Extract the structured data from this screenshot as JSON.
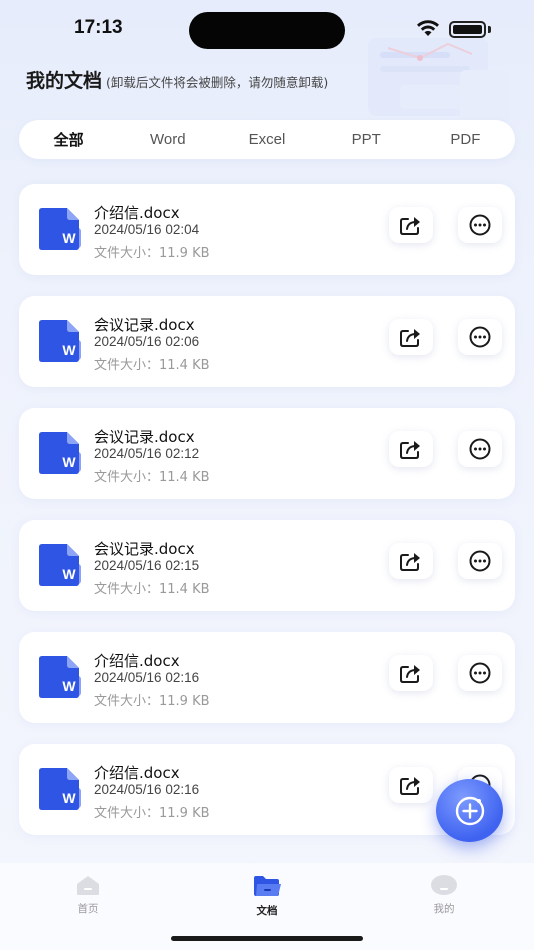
{
  "status": {
    "time": "17:13"
  },
  "header": {
    "title": "我的文档",
    "subtitle": "(卸载后文件将会被删除，请勿随意卸载)"
  },
  "filter_tabs": [
    {
      "label": "全部",
      "active": true
    },
    {
      "label": "Word",
      "active": false
    },
    {
      "label": "Excel",
      "active": false
    },
    {
      "label": "PPT",
      "active": false
    },
    {
      "label": "PDF",
      "active": false
    }
  ],
  "files": [
    {
      "name": "介绍信.docx",
      "date": "2024/05/16 02:04",
      "size": "文件大小：11.9 KB"
    },
    {
      "name": "会议记录.docx",
      "date": "2024/05/16 02:06",
      "size": "文件大小：11.4 KB"
    },
    {
      "name": "会议记录.docx",
      "date": "2024/05/16 02:12",
      "size": "文件大小：11.4 KB"
    },
    {
      "name": "会议记录.docx",
      "date": "2024/05/16 02:15",
      "size": "文件大小：11.4 KB"
    },
    {
      "name": "介绍信.docx",
      "date": "2024/05/16 02:16",
      "size": "文件大小：11.9 KB"
    },
    {
      "name": "介绍信.docx",
      "date": "2024/05/16 02:16",
      "size": "文件大小：11.9 KB"
    }
  ],
  "file_icon": {
    "name": "word-file-icon",
    "glyph": "W"
  },
  "bottom_nav": [
    {
      "label": "首页",
      "icon": "home-icon",
      "active": false
    },
    {
      "label": "文档",
      "icon": "folder-icon",
      "active": true
    },
    {
      "label": "我的",
      "icon": "profile-icon",
      "active": false
    }
  ],
  "colors": {
    "accent": "#3553e6",
    "word_blue": "#2f55e4",
    "background": "#eef2fc"
  }
}
